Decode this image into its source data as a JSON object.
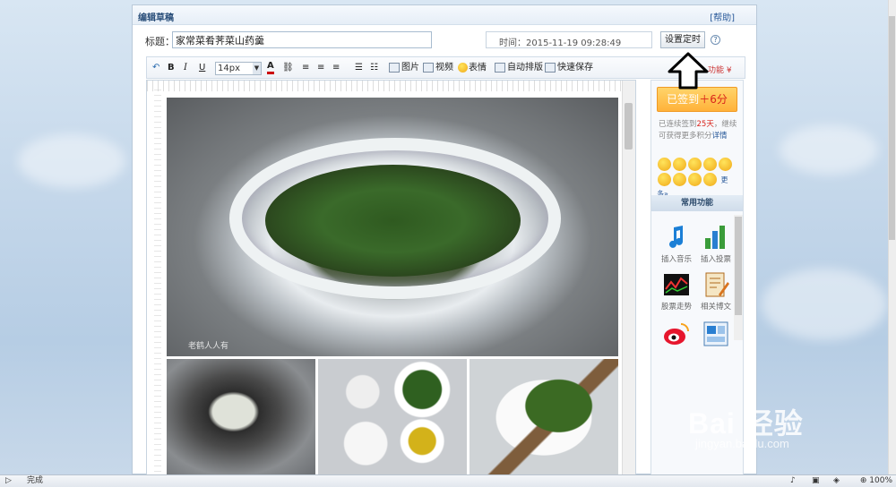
{
  "panel": {
    "title": "编辑草稿",
    "help": "[帮助]"
  },
  "title_field": {
    "label": "标题：",
    "value": "家常菜肴荠菜山药羹"
  },
  "time_field": {
    "value": "时间：2015-11-19 09:28:49"
  },
  "set_time_label": "设置定时",
  "help_icon": "?",
  "toolbar": {
    "font_size": "14px",
    "bold": "B",
    "italic": "I",
    "underline": "U",
    "font_color": "A",
    "image": "图片",
    "video": "视频",
    "emoticon": "表情",
    "auto_layout": "自动排版",
    "quick_save": "快速保存",
    "more": "功能 ¥"
  },
  "editor": {
    "watermark": "老鹤人人有"
  },
  "sidebar": {
    "checkin": "已签到",
    "checkin_points": "＋6分",
    "streak_pre": "已连续签到",
    "streak_days": "25天",
    "streak_post": "，继续可获得更多积分",
    "streak_link": "详情",
    "emoji_more": "更多»",
    "common_title": "常用功能",
    "functions": [
      "插入音乐",
      "插入投票",
      "股票走势",
      "相关博文"
    ]
  },
  "statusbar": {
    "status": "完成",
    "zoom": "100%"
  },
  "watermark": {
    "brand": "Bai  经验",
    "url": "jingyan.baidu.com"
  }
}
